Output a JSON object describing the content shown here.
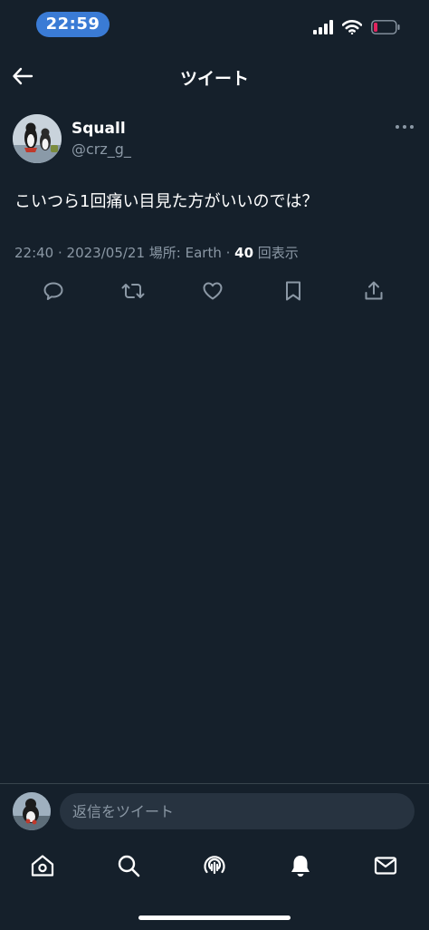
{
  "status_bar": {
    "time": "22:59",
    "icons": [
      "cellular-signal-icon",
      "wifi-icon",
      "battery-low-icon"
    ]
  },
  "header": {
    "back_icon": "arrow-left-icon",
    "title": "ツイート"
  },
  "tweet": {
    "author": {
      "display_name": "Squall",
      "handle": "@crz_g_",
      "avatar_icon": "user-avatar"
    },
    "more_icon": "more-horizontal-icon",
    "text": "こいつら1回痛い目見た方がいいのでは？",
    "meta": {
      "time": "22:40",
      "separator1": " · ",
      "date": "2023/05/21",
      "location": " 場所: Earth",
      "separator2": " · ",
      "views_count": "40",
      "views_label": " 回表示"
    },
    "actions": [
      {
        "name": "reply",
        "icon": "reply-bubble-icon"
      },
      {
        "name": "retweet",
        "icon": "retweet-icon"
      },
      {
        "name": "like",
        "icon": "heart-icon"
      },
      {
        "name": "bookmark",
        "icon": "bookmark-icon"
      },
      {
        "name": "share",
        "icon": "share-icon"
      }
    ]
  },
  "reply_bar": {
    "placeholder": "返信をツイート"
  },
  "tab_bar": {
    "tabs": [
      {
        "name": "home",
        "icon": "home-icon"
      },
      {
        "name": "search",
        "icon": "search-icon"
      },
      {
        "name": "spaces",
        "icon": "spaces-icon"
      },
      {
        "name": "notifications",
        "icon": "bell-icon"
      },
      {
        "name": "messages",
        "icon": "mail-icon"
      }
    ]
  },
  "colors": {
    "background": "#15202b",
    "text_primary": "#ffffff",
    "text_secondary": "#8b98a5",
    "accent_time_pill": "#3a7bd5",
    "battery_low": "#e0245e",
    "input_background": "#273340",
    "divider": "#38444d"
  }
}
